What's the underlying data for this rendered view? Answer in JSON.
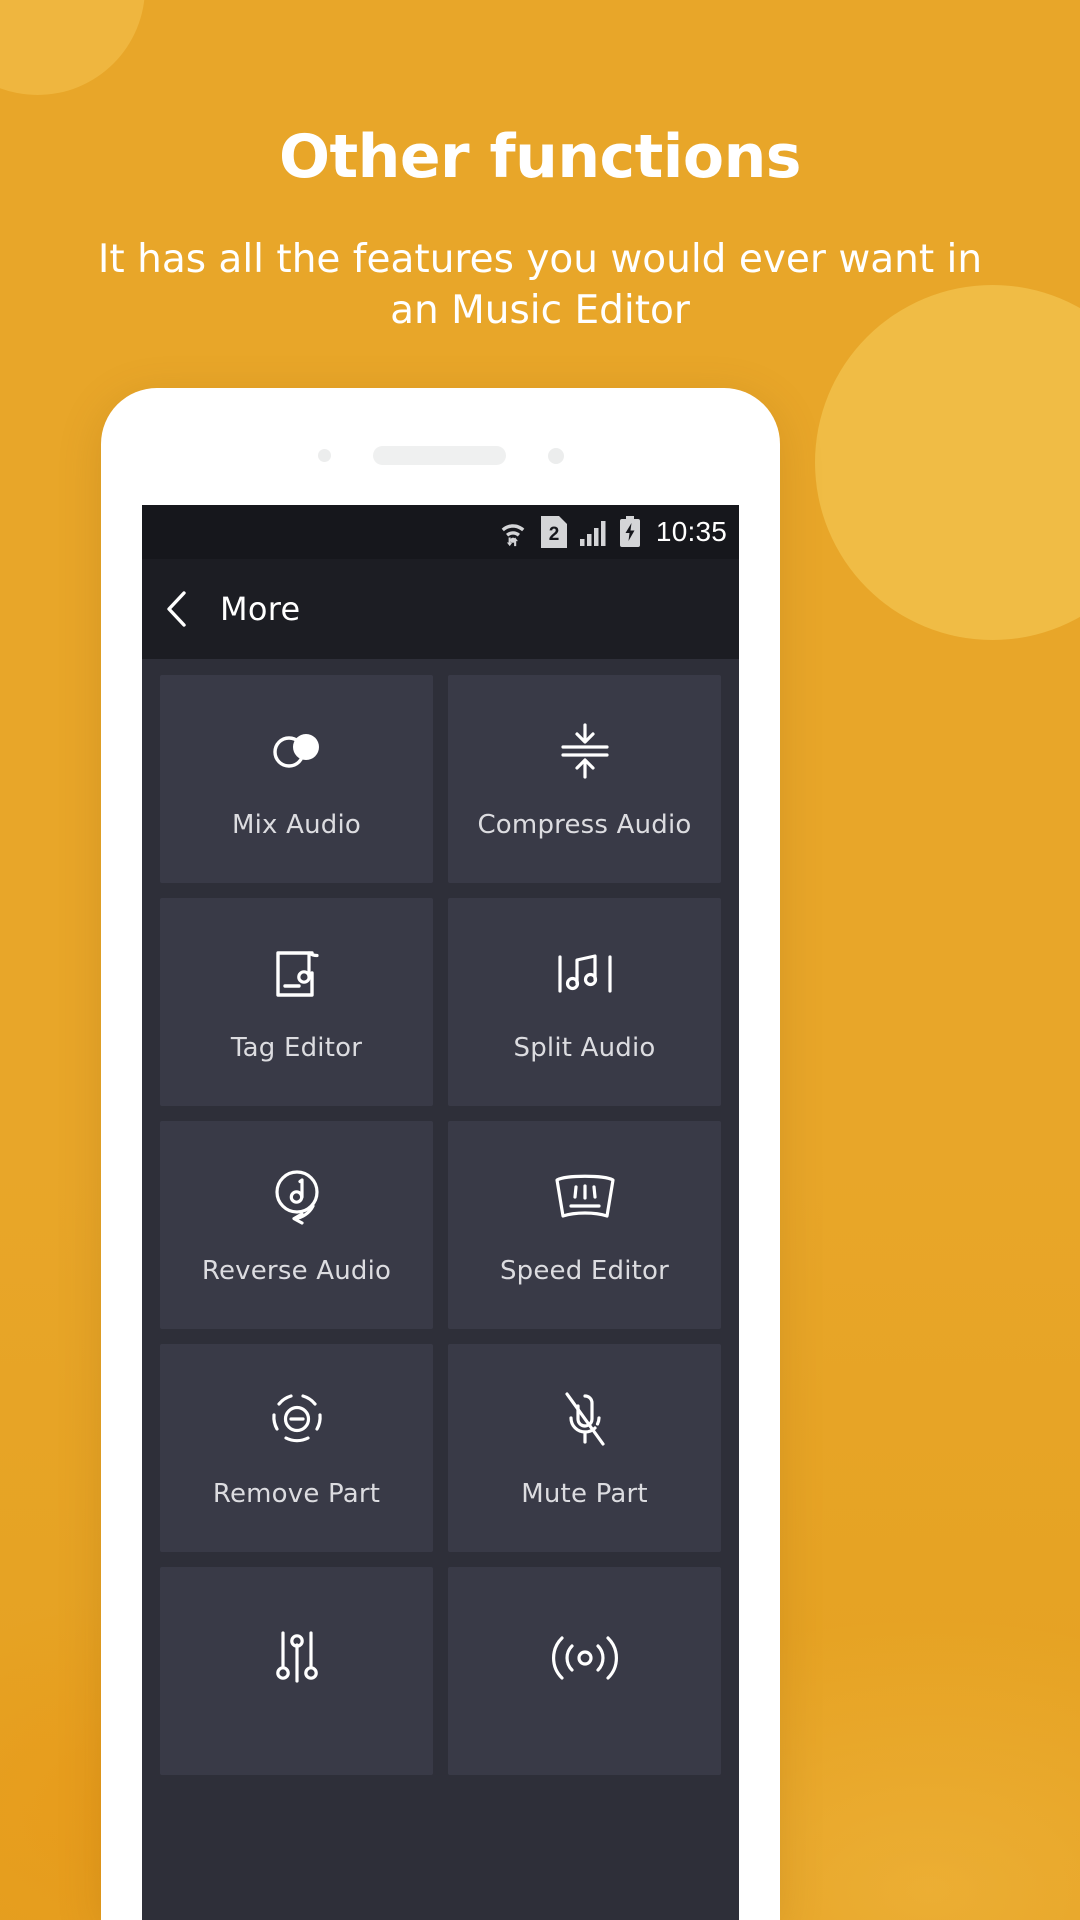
{
  "promo": {
    "headline": "Other functions",
    "subheadline": "It has all the features you would ever want in an Music Editor",
    "background_color": "#e8a629",
    "text_color": "#ffffff"
  },
  "phone": {
    "screen_background": "#2e2f39",
    "status_bar": {
      "background": "#16171c",
      "time": "10:35",
      "icons": [
        "wifi-data-transfer-icon",
        "sim2-icon",
        "signal-bars-icon",
        "battery-charging-icon"
      ]
    },
    "toolbar": {
      "background": "#1c1d23",
      "back_icon": "back-chevron-icon",
      "title": "More"
    },
    "grid": {
      "tile_background": "#393a47",
      "label_color": "#dcdce0",
      "items": [
        {
          "label": "Mix Audio",
          "icon": "mix-audio-icon"
        },
        {
          "label": "Compress Audio",
          "icon": "compress-audio-icon"
        },
        {
          "label": "Tag Editor",
          "icon": "tag-editor-icon"
        },
        {
          "label": "Split Audio",
          "icon": "split-audio-icon"
        },
        {
          "label": "Reverse Audio",
          "icon": "reverse-audio-icon"
        },
        {
          "label": "Speed Editor",
          "icon": "speed-editor-icon"
        },
        {
          "label": "Remove Part",
          "icon": "remove-part-icon"
        },
        {
          "label": "Mute Part",
          "icon": "mute-part-icon"
        },
        {
          "label": "",
          "icon": "equalizer-icon"
        },
        {
          "label": "",
          "icon": "audio-waves-icon"
        }
      ]
    }
  }
}
